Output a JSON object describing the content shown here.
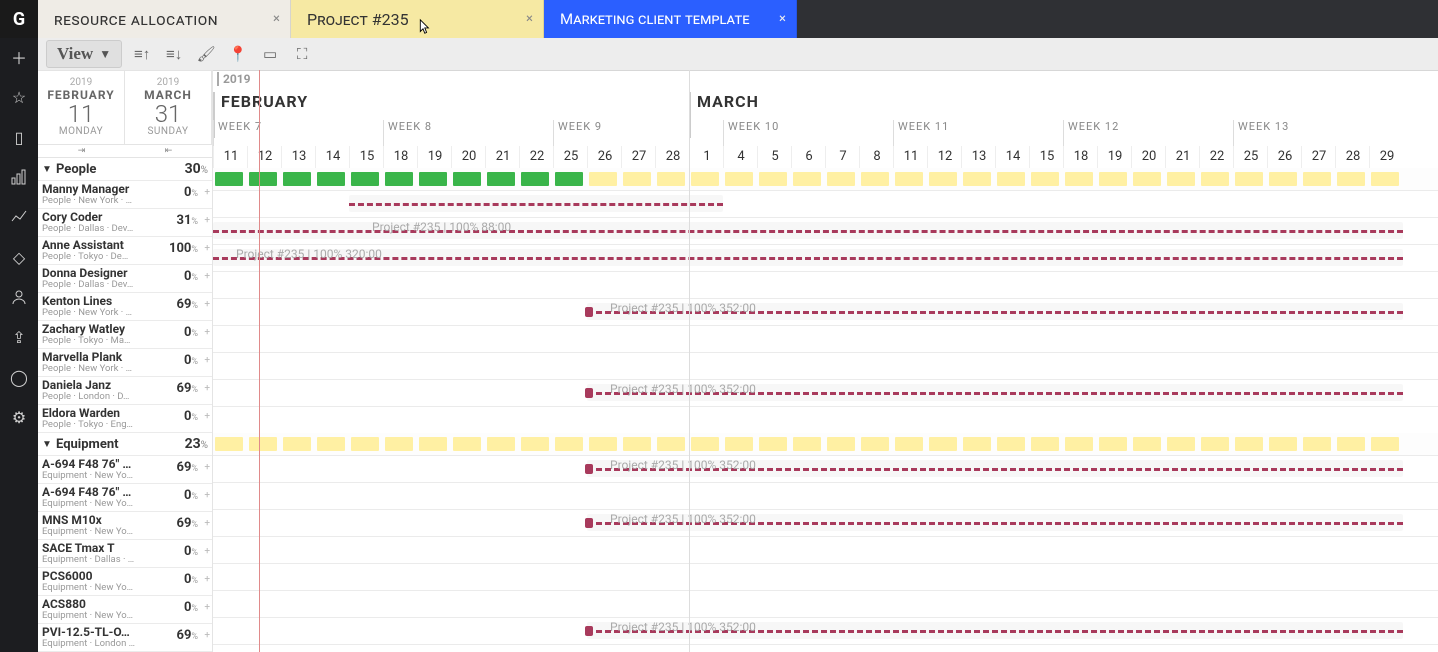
{
  "tabs": [
    {
      "label": "RESOURCE ALLOCATION",
      "state": "active"
    },
    {
      "label": "Project #235",
      "state": "hover"
    },
    {
      "label": "Marketing client template",
      "state": "blue"
    }
  ],
  "toolbar": {
    "view_label": "View"
  },
  "range": {
    "start": {
      "year": "2019",
      "month": "FEBRUARY",
      "day": "11",
      "dow": "MONDAY"
    },
    "end": {
      "year": "2019",
      "month": "MARCH",
      "day": "31",
      "dow": "SUNDAY"
    }
  },
  "timeline": {
    "year": "2019",
    "months": [
      {
        "label": "FEBRUARY",
        "startDay": 0
      },
      {
        "label": "MARCH",
        "startDay": 14
      }
    ],
    "weeks": [
      {
        "label": "WEEK 7",
        "startDay": 0
      },
      {
        "label": "WEEK 8",
        "startDay": 5
      },
      {
        "label": "WEEK 9",
        "startDay": 10
      },
      {
        "label": "WEEK 10",
        "startDay": 15
      },
      {
        "label": "WEEK 11",
        "startDay": 20
      },
      {
        "label": "WEEK 12",
        "startDay": 25
      },
      {
        "label": "WEEK 13",
        "startDay": 30
      }
    ],
    "days": [
      11,
      12,
      13,
      14,
      15,
      18,
      19,
      20,
      21,
      22,
      25,
      26,
      27,
      28,
      1,
      4,
      5,
      6,
      7,
      8,
      11,
      12,
      13,
      14,
      15,
      18,
      19,
      20,
      21,
      22,
      25,
      26,
      27,
      28,
      29
    ],
    "dayWidth": 34,
    "todayIndex": 1.35
  },
  "groups": [
    {
      "name": "People",
      "util": "30",
      "unit": "%",
      "utilFullEnd": 11,
      "rows": [
        {
          "name": "Manny Manager",
          "sub": "People · New York · …",
          "util": "0",
          "bars": [
            {
              "from": 4,
              "to": 15,
              "label": "",
              "track": true
            }
          ]
        },
        {
          "name": "Cory Coder",
          "sub": "People · Dallas · Dev…",
          "util": "31",
          "bars": [
            {
              "from": 0,
              "to": 35,
              "label": "Project #235 | 100% 88:00",
              "labelAt": 4.5,
              "track": true
            }
          ]
        },
        {
          "name": "Anne Assistant",
          "sub": "People · Tokyo · De…",
          "util": "100",
          "bars": [
            {
              "from": 0,
              "to": 35,
              "label": "Project #235 | 100% 320:00",
              "labelAt": 0.5,
              "track": true
            }
          ]
        },
        {
          "name": "Donna Designer",
          "sub": "People · Dallas · Dev…",
          "util": "0",
          "bars": []
        },
        {
          "name": "Kenton Lines",
          "sub": "People · New York · …",
          "util": "69",
          "bars": [
            {
              "from": 11,
              "to": 35,
              "label": "Project #235 | 100% 352:00",
              "labelAt": 11.5,
              "track": true,
              "handle": true
            }
          ]
        },
        {
          "name": "Zachary Watley",
          "sub": "People · Tokyo · Ma…",
          "util": "0",
          "bars": []
        },
        {
          "name": "Marvella Plank",
          "sub": "People · New York · …",
          "util": "0",
          "bars": []
        },
        {
          "name": "Daniela Janz",
          "sub": "People · London · D…",
          "util": "69",
          "bars": [
            {
              "from": 11,
              "to": 35,
              "label": "Project #235 | 100% 352:00",
              "labelAt": 11.5,
              "track": true,
              "handle": true
            }
          ]
        },
        {
          "name": "Eldora Warden",
          "sub": "People · Tokyo · Eng…",
          "util": "0",
          "bars": []
        }
      ]
    },
    {
      "name": "Equipment",
      "util": "23",
      "unit": "%",
      "utilFullEnd": 0,
      "rows": [
        {
          "name": "A-694 F48 76\" …",
          "sub": "Equipment · New Yo…",
          "util": "69",
          "bars": [
            {
              "from": 11,
              "to": 35,
              "label": "Project #235 | 100% 352:00",
              "labelAt": 11.5,
              "track": true,
              "handle": true
            }
          ]
        },
        {
          "name": "A-694 F48 76\" …",
          "sub": "Equipment · New Yo…",
          "util": "0",
          "bars": []
        },
        {
          "name": "MNS M10x",
          "sub": "Equipment · New Yo…",
          "util": "69",
          "bars": [
            {
              "from": 11,
              "to": 35,
              "label": "Project #235 | 100% 352:00",
              "labelAt": 11.5,
              "track": true,
              "handle": true
            }
          ]
        },
        {
          "name": "SACE Tmax T",
          "sub": "Equipment · Dallas · …",
          "util": "0",
          "bars": []
        },
        {
          "name": "PCS6000",
          "sub": "Equipment · New Yo…",
          "util": "0",
          "bars": []
        },
        {
          "name": "ACS880",
          "sub": "Equipment · New Yo…",
          "util": "0",
          "bars": []
        },
        {
          "name": "PVI-12.5-TL-O…",
          "sub": "Equipment · London …",
          "util": "69",
          "bars": [
            {
              "from": 11,
              "to": 35,
              "label": "Project #235 | 100% 352:00",
              "labelAt": 11.5,
              "track": true,
              "handle": true
            }
          ]
        }
      ]
    }
  ]
}
